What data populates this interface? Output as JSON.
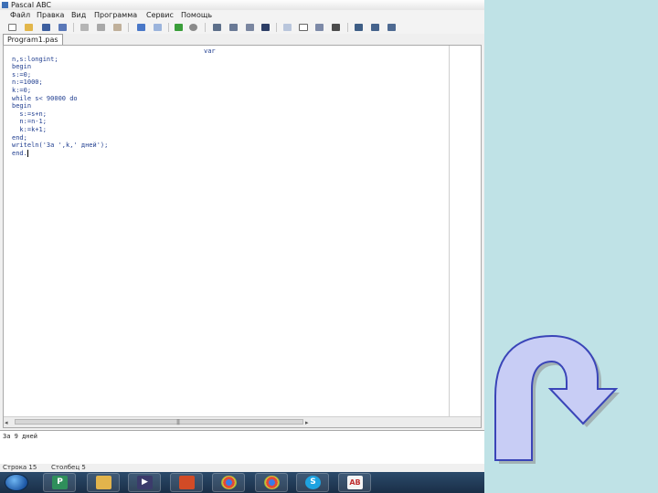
{
  "window": {
    "title": "Pascal ABC"
  },
  "menu": {
    "items": [
      "Файл",
      "Правка",
      "Вид",
      "Программа",
      "Сервис",
      "Помощь"
    ]
  },
  "tabs": {
    "program": "Program1.pas"
  },
  "editor": {
    "code": [
      "var",
      "n,s:longint;",
      "begin",
      "s:=0;",
      "n:=1000;",
      "k:=0;",
      "while s< 90000 do",
      "begin",
      "  s:=s+n;",
      "  n:=n-1;",
      "  k:=k+1;",
      "end;",
      "writeln('За ',k,' дней');",
      "end."
    ]
  },
  "output": {
    "text": "За 9 дней"
  },
  "status": {
    "line": "Строка 15",
    "column": "Столбец 5"
  },
  "colors": {
    "slide_background": "#bfe2e6",
    "code_text": "#1f3d8f",
    "arrow_fill": "#c8cdf5",
    "arrow_outline": "#3a45b8"
  },
  "taskbar": {
    "apps": [
      "paint-app",
      "folder-app",
      "media-player-app",
      "presentation-app",
      "chrome-app",
      "browser-app",
      "skype-app",
      "abc-app"
    ]
  }
}
